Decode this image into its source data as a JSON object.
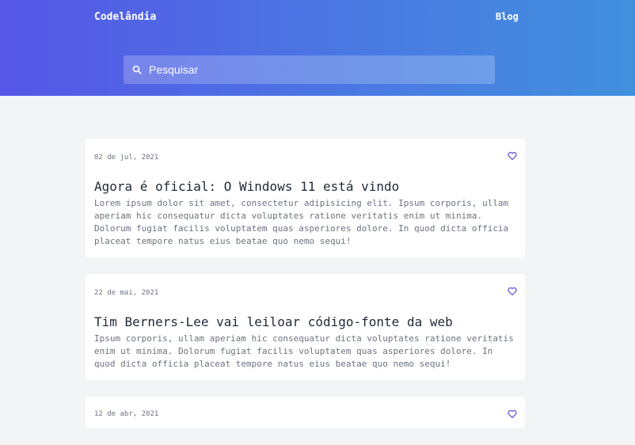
{
  "header": {
    "brand": "Codelândia",
    "nav_blog": "Blog"
  },
  "search": {
    "placeholder": "Pesquisar",
    "icon": "search-icon"
  },
  "posts": [
    {
      "date": "02 de jul, 2021",
      "title": "Agora é oficial: O Windows 11 está vindo",
      "excerpt": "Lorem ipsum dolor sit amet, consectetur adipisicing elit. Ipsum corporis, ullam aperiam hic consequatur dicta voluptates ratione veritatis enim ut minima. Dolorum fugiat facilis voluptatem quas asperiores dolore. In quod dicta officia placeat tempore natus eius beatae quo nemo sequi!"
    },
    {
      "date": "22 de mai, 2021",
      "title": "Tim Berners-Lee vai leiloar código-fonte da web",
      "excerpt": "Ipsum corporis, ullam aperiam hic consequatur dicta voluptates ratione veritatis enim ut minima. Dolorum fugiat facilis voluptatem quas asperiores dolore. In quod dicta officia placeat tempore natus eius beatae quo nemo sequi!"
    },
    {
      "date": "12 de abr, 2021"
    }
  ],
  "colors": {
    "accent": "#5b4fd9",
    "gradient_start": "#5656e6",
    "gradient_end": "#4190de"
  }
}
